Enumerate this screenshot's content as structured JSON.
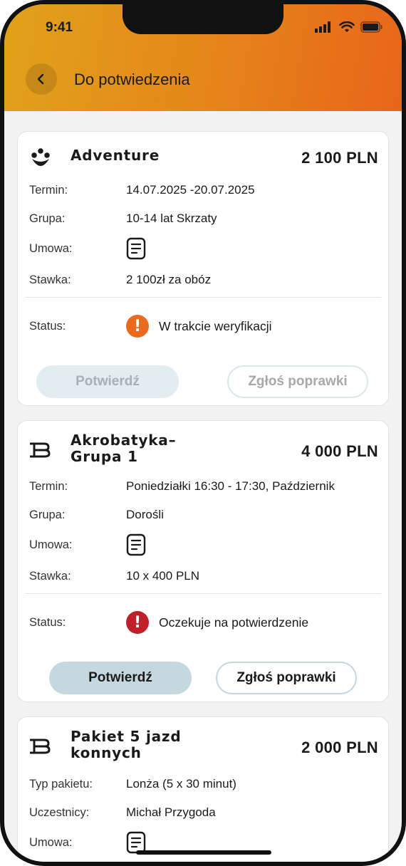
{
  "status_bar": {
    "time": "9:41"
  },
  "header": {
    "title": "Do potwiedzenia",
    "back_icon": "chevron-left-icon"
  },
  "cards": [
    {
      "icon": "smiley-icon",
      "name": "Adventure",
      "price": "2 100 PLN",
      "rows": [
        {
          "label": "Termin:",
          "value": "14.07.2025 -20.07.2025"
        },
        {
          "label": "Grupa:",
          "value": "10-14 lat Skrzaty"
        },
        {
          "label": "Umowa:",
          "value": "",
          "icon": "document-icon"
        },
        {
          "label": "Stawka:",
          "value": "2 100zł za obóz"
        }
      ],
      "status": {
        "label": "Status:",
        "text": "W trakcie weryfikacji",
        "color": "#ea6a20"
      },
      "confirm_label": "Potwierdź",
      "report_label": "Zgłoś poprawki",
      "buttons_enabled": false
    },
    {
      "icon": "brand-b-icon",
      "name": "Akrobatyka– Grupa 1",
      "price": "4 000 PLN",
      "rows": [
        {
          "label": "Termin:",
          "value": "Poniedziałki 16:30 - 17:30, Październik"
        },
        {
          "label": "Grupa:",
          "value": "Dorośli"
        },
        {
          "label": "Umowa:",
          "value": "",
          "icon": "document-icon"
        },
        {
          "label": "Stawka:",
          "value": "10 x 400 PLN"
        }
      ],
      "status": {
        "label": "Status:",
        "text": "Oczekuje na potwierdzenie",
        "color": "#c0202a"
      },
      "confirm_label": "Potwierdź",
      "report_label": "Zgłoś poprawki",
      "buttons_enabled": true
    },
    {
      "icon": "brand-b-icon",
      "name": "Pakiet 5 jazd konnych",
      "price": "2 000 PLN",
      "rows": [
        {
          "label": "Typ pakietu:",
          "value": "Lonża (5 x 30 minut)"
        },
        {
          "label": "Uczestnicy:",
          "value": "Michał Przygoda"
        },
        {
          "label": "Umowa:",
          "value": "",
          "icon": "document-icon"
        }
      ]
    }
  ]
}
